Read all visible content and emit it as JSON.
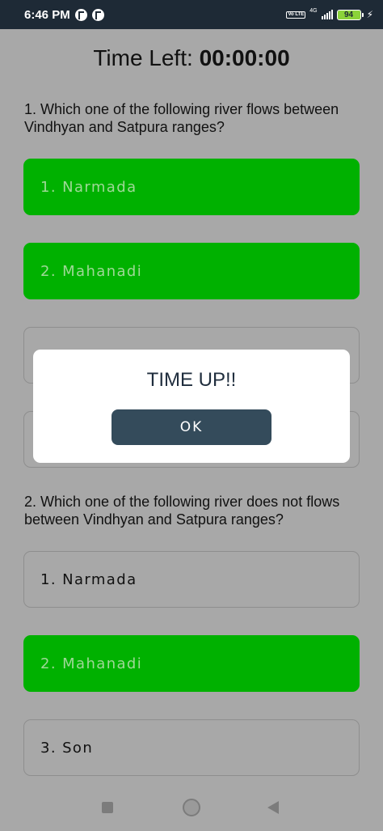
{
  "status_bar": {
    "time": "6:46 PM",
    "volte_label": "Vo LTE",
    "network_label": "4G",
    "battery_level": "94",
    "icons": [
      "app-notification-icon",
      "volte-icon",
      "signal-icon",
      "battery-icon",
      "charging-icon"
    ]
  },
  "timer": {
    "label": "Time Left:",
    "value": "00:00:00"
  },
  "questions": [
    {
      "text": "1. Which one of the following river flows between Vindhyan and Satpura ranges?",
      "options": [
        {
          "label": "1. Narmada",
          "selected": true
        },
        {
          "label": "2. Mahanadi",
          "selected": true
        },
        {
          "label": "",
          "selected": false
        },
        {
          "label": "",
          "selected": false
        }
      ]
    },
    {
      "text": "2. Which one of the following river does not flows between Vindhyan and Satpura ranges?",
      "options": [
        {
          "label": "1. Narmada",
          "selected": false
        },
        {
          "label": "2. Mahanadi",
          "selected": true
        },
        {
          "label": "3. Son",
          "selected": false
        }
      ]
    }
  ],
  "dialog": {
    "title": "TIME UP!!",
    "ok_label": "OK"
  },
  "colors": {
    "selected_option": "#00b100",
    "overlay_background": "#a8a8a8",
    "dialog_button": "#344b5b",
    "status_bar": "#1e2a36"
  }
}
